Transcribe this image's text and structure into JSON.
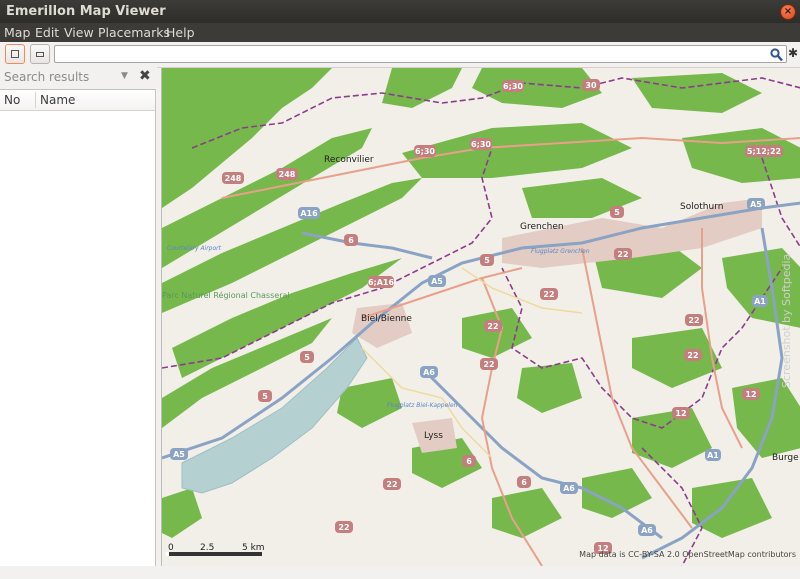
{
  "window": {
    "title": "Emerillon Map Viewer",
    "close_glyph": "×"
  },
  "menu": [
    {
      "label": "Map"
    },
    {
      "label": "Edit"
    },
    {
      "label": "View"
    },
    {
      "label": "Placemarks"
    },
    {
      "label": "Help"
    }
  ],
  "toolbar": {
    "search_value": "",
    "search_icon": "search-icon",
    "bug_glyph": "✱"
  },
  "sidebar": {
    "search_results_label": "Search results",
    "close_glyph": "✖",
    "columns": {
      "no": "No",
      "name": "Name"
    }
  },
  "map": {
    "places": [
      "Reconvilier",
      "Grenchen",
      "Solothurn",
      "Biel/Bienne",
      "Lyss",
      "Burge",
      "Parc Naturel Régional Chasseral"
    ],
    "roads": [
      "6;30",
      "30",
      "6;30",
      "6;30",
      "5;12;22",
      "248",
      "248",
      "A16",
      "6",
      "5",
      "6;A16",
      "A5",
      "5",
      "22",
      "22",
      "22",
      "A5",
      "A1",
      "22",
      "5",
      "A6",
      "5",
      "22",
      "22",
      "12",
      "12",
      "A1",
      "6",
      "6",
      "A6",
      "A6",
      "22",
      "A5",
      "22",
      "12"
    ],
    "airports": [
      "Courtelary Airport",
      "Flugplatz Grenchen",
      "Flugplatz Biel-Kappelen"
    ],
    "scale": {
      "zero": "0",
      "half": "2.5",
      "end": "5 km"
    },
    "attribution": "Map data is CC-BY-SA 2.0 OpenStreetMap contributors",
    "watermark": "Screenshot by Softpedia",
    "colors": {
      "land": "#f2efe9",
      "forest": "#76b84b",
      "lake": "#b5d0d0",
      "motorway": "#8aa3c4",
      "road_shield": "#c57e7e",
      "border": "#8c3c8c"
    }
  }
}
